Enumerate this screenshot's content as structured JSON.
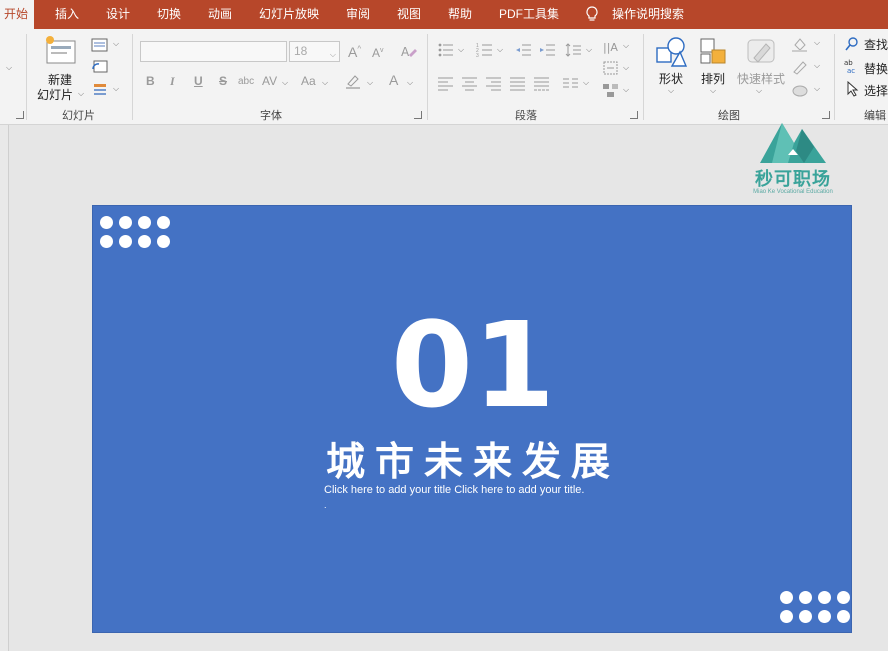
{
  "tabs": [
    {
      "label": "开始",
      "active": true
    },
    {
      "label": "插入"
    },
    {
      "label": "设计"
    },
    {
      "label": "切换"
    },
    {
      "label": "动画"
    },
    {
      "label": "幻灯片放映"
    },
    {
      "label": "审阅"
    },
    {
      "label": "视图"
    },
    {
      "label": "帮助"
    },
    {
      "label": "PDF工具集"
    }
  ],
  "tell_me": {
    "label": "操作说明搜索",
    "icon": "lightbulb-icon"
  },
  "ribbon": {
    "slides_group": {
      "new_slide_line1": "新建",
      "new_slide_line2": "幻灯片",
      "label": "幻灯片"
    },
    "font_group": {
      "font_name": "",
      "font_size": "18",
      "label": "字体",
      "format_buttons": [
        "B",
        "I",
        "U",
        "S",
        "abc",
        "AV",
        "Aa"
      ]
    },
    "paragraph_group": {
      "label": "段落"
    },
    "drawing_group": {
      "shape_label": "形状",
      "arrange_label": "排列",
      "quick_styles_label": "快速样式",
      "label": "绘图"
    },
    "editing_group": {
      "find_label": "查找",
      "replace_label": "替换",
      "select_label": "选择",
      "label": "编辑"
    }
  },
  "slide": {
    "number": "01",
    "title": "城市未来发展",
    "subtitle": "Click here to add your title Click here to add your title.",
    "trailing": "."
  },
  "watermark": {
    "text": "秒可职场",
    "sub": "Miao Ke Vocational Education"
  },
  "colors": {
    "tab_bar": "#b7472a",
    "slide_bg": "#4472c4",
    "watermark": "#3aa39a"
  }
}
